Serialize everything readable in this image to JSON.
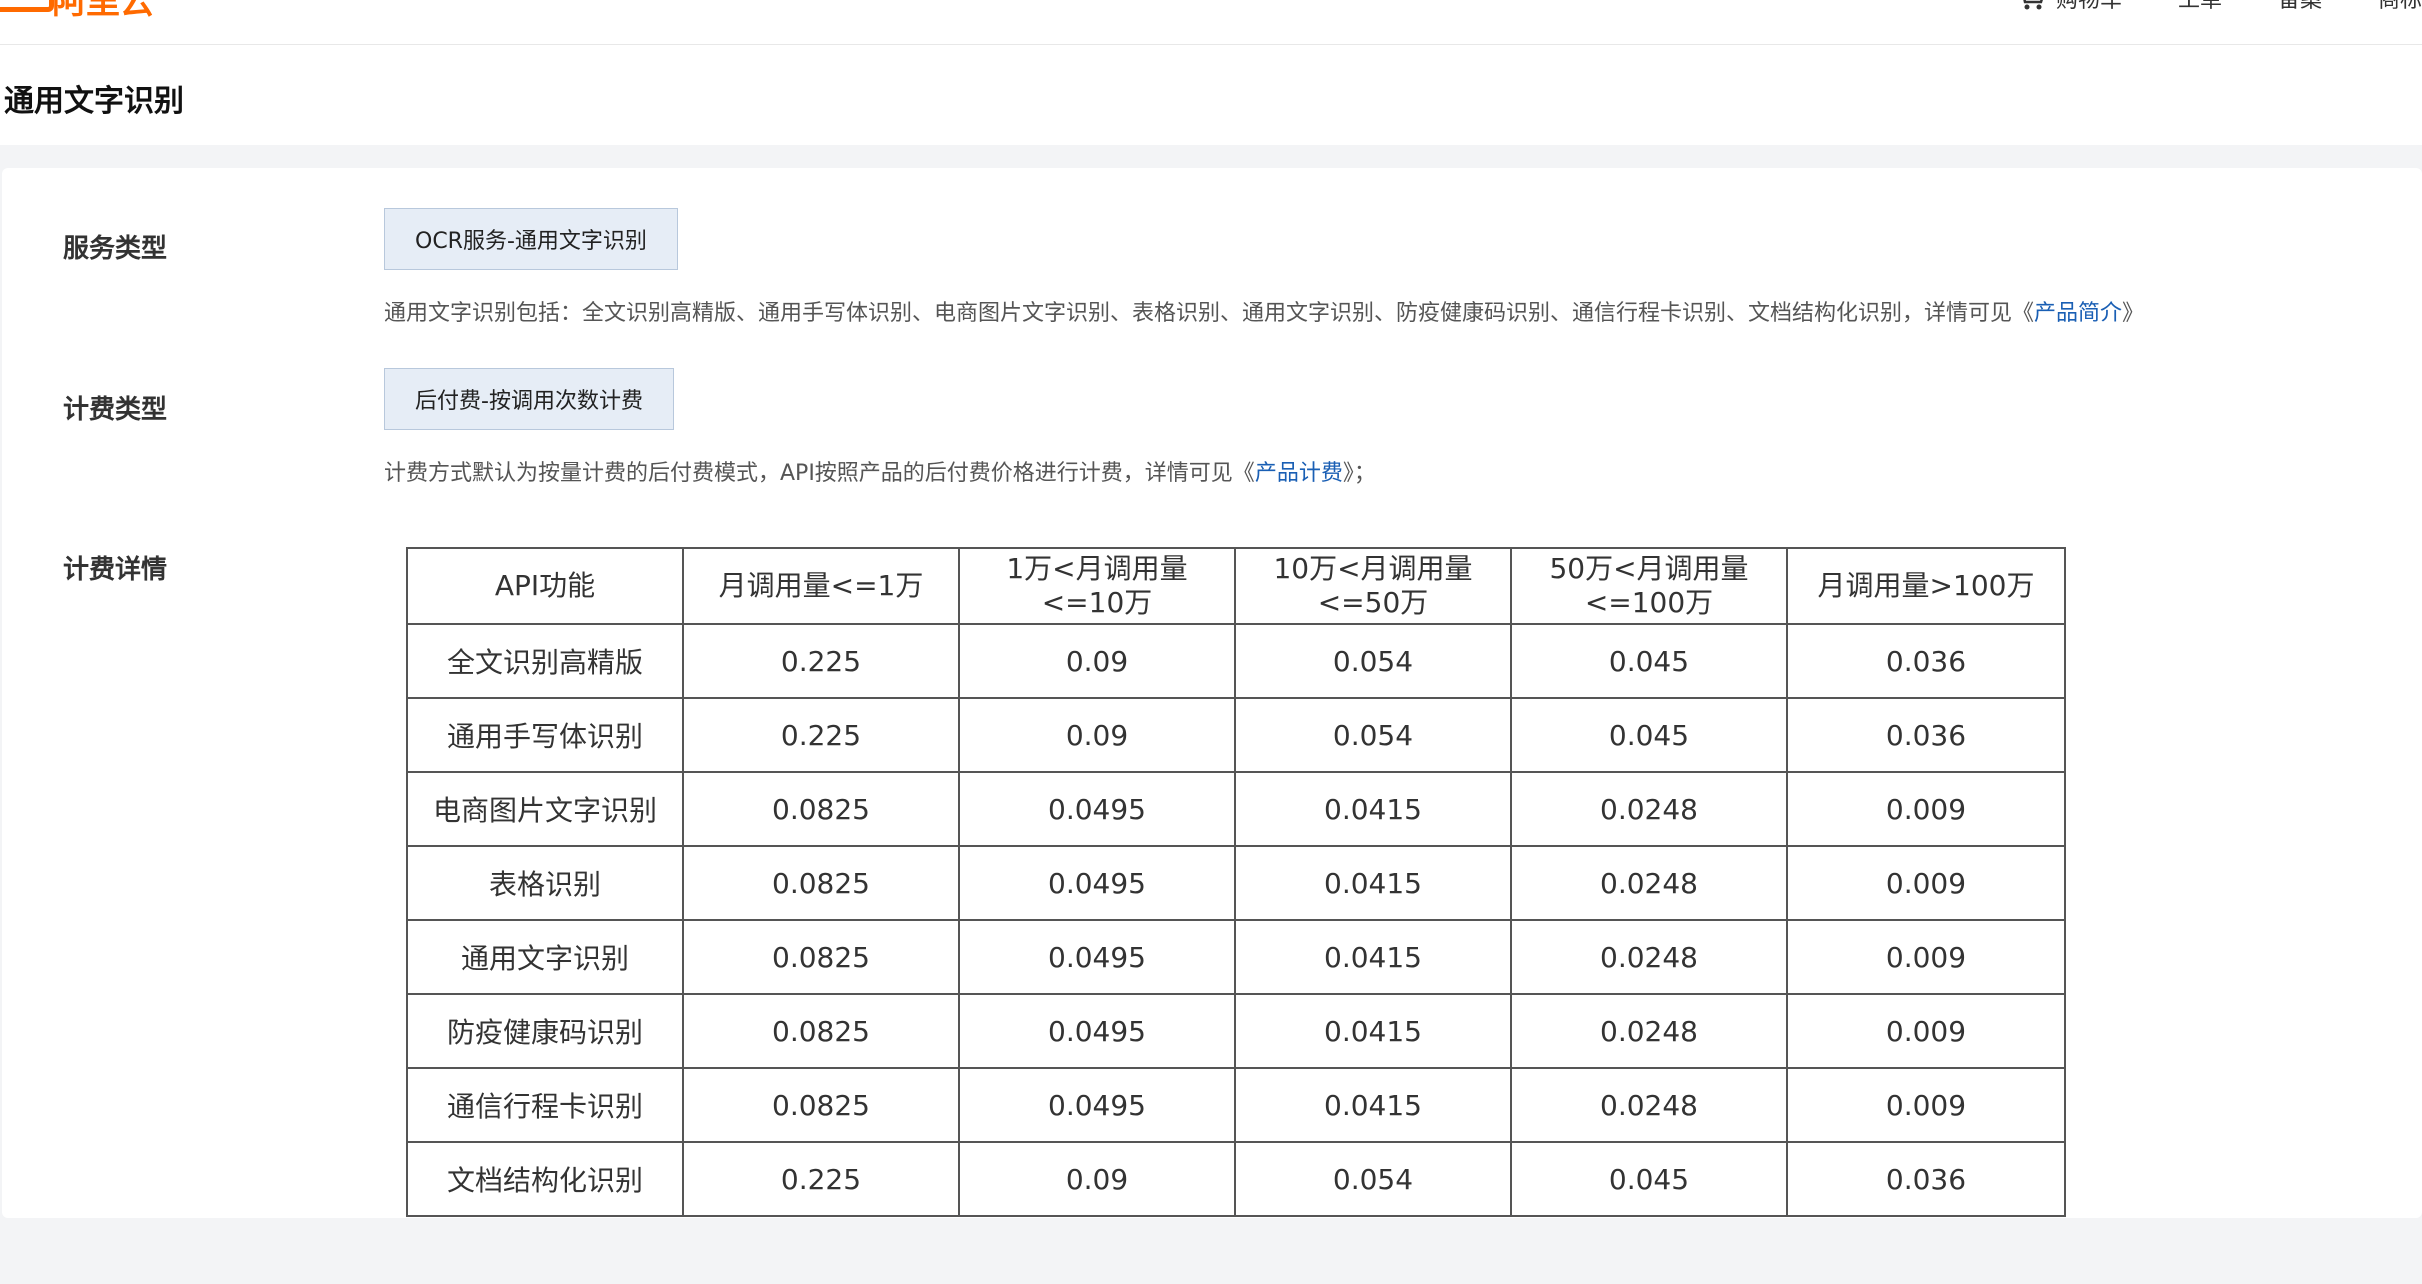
{
  "header": {
    "brand": "阿里云",
    "nav": [
      "购物车",
      "工单",
      "备案",
      "商标"
    ]
  },
  "page_title": "通用文字识别",
  "service_type": {
    "label": "服务类型",
    "value": "OCR服务-通用文字识别",
    "desc_text": "通用文字识别包括：全文识别高精版、通用手写体识别、电商图片文字识别、表格识别、通用文字识别、防疫健康码识别、通信行程卡识别、文档结构化识别，详情可见《",
    "desc_link": "产品简介",
    "desc_suffix": "》"
  },
  "billing_type": {
    "label": "计费类型",
    "value": "后付费-按调用次数计费",
    "desc_text": "计费方式默认为按量计费的后付费模式，API按照产品的后付费价格进行计费，详情可见《",
    "desc_link": "产品计费",
    "desc_suffix": "》；"
  },
  "billing_details": {
    "label": "计费详情",
    "columns": [
      "API功能",
      "月调用量<=1万",
      "1万<月调用量<=10万",
      "10万<月调用量<=50万",
      "50万<月调用量<=100万",
      "月调用量>100万"
    ],
    "rows": [
      [
        "全文识别高精版",
        "0.225",
        "0.09",
        "0.054",
        "0.045",
        "0.036"
      ],
      [
        "通用手写体识别",
        "0.225",
        "0.09",
        "0.054",
        "0.045",
        "0.036"
      ],
      [
        "电商图片文字识别",
        "0.0825",
        "0.0495",
        "0.0415",
        "0.0248",
        "0.009"
      ],
      [
        "表格识别",
        "0.0825",
        "0.0495",
        "0.0415",
        "0.0248",
        "0.009"
      ],
      [
        "通用文字识别",
        "0.0825",
        "0.0495",
        "0.0415",
        "0.0248",
        "0.009"
      ],
      [
        "防疫健康码识别",
        "0.0825",
        "0.0495",
        "0.0415",
        "0.0248",
        "0.009"
      ],
      [
        "通信行程卡识别",
        "0.0825",
        "0.0495",
        "0.0415",
        "0.0248",
        "0.009"
      ],
      [
        "文档结构化识别",
        "0.225",
        "0.09",
        "0.054",
        "0.045",
        "0.036"
      ]
    ]
  }
}
